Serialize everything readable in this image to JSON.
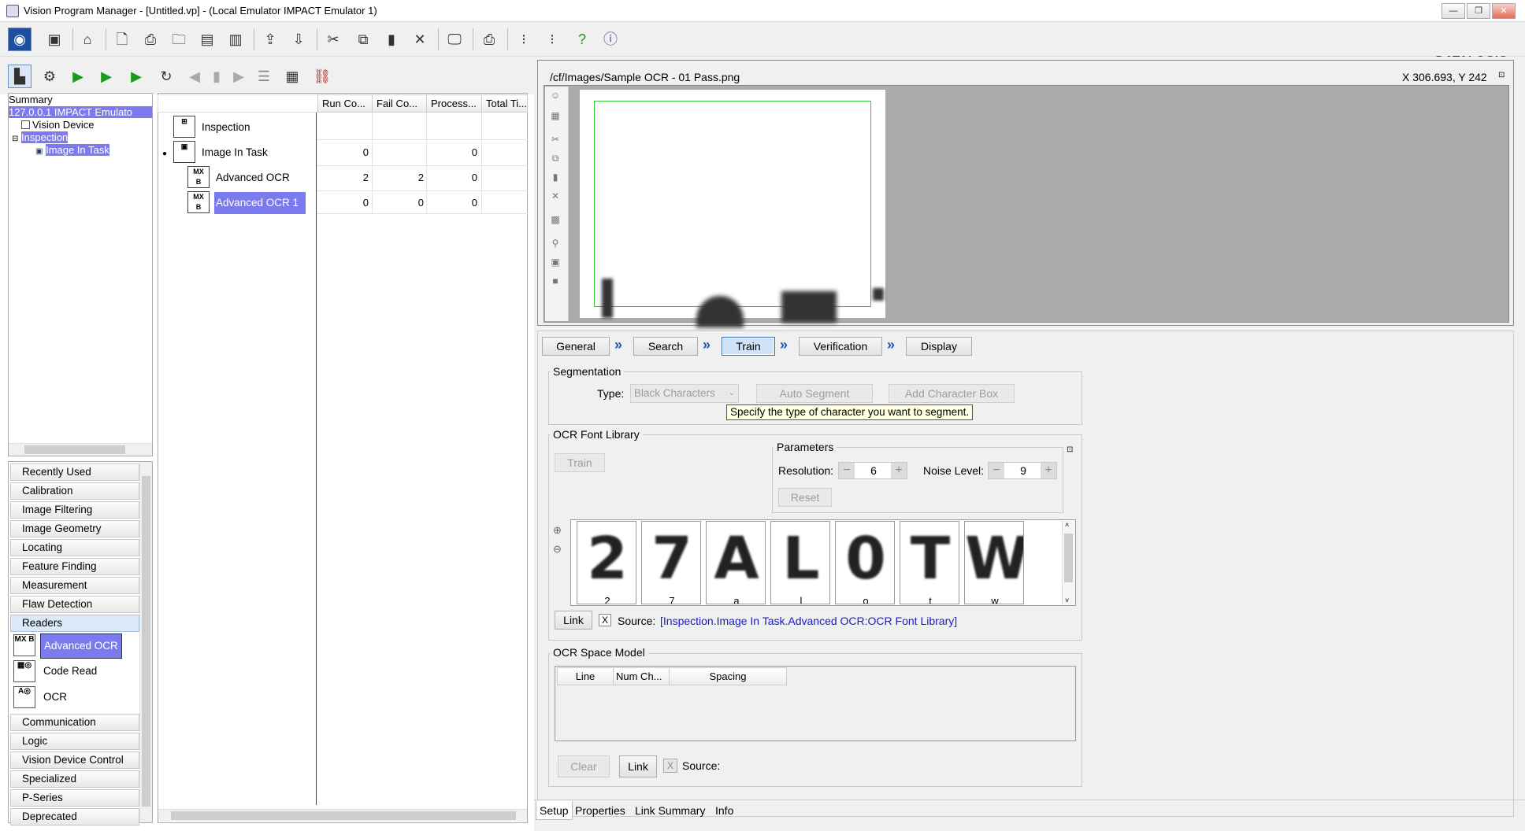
{
  "window": {
    "title": "Vision Program Manager - [Untitled.vp] - (Local Emulator IMPACT Emulator 1)",
    "minimize": "—",
    "restore": "❐",
    "close": "✕"
  },
  "brand": {
    "logo": "DATALOGIC"
  },
  "tree": {
    "items": [
      "Summary",
      "127.0.0.1 IMPACT Emulato",
      "Vision Device",
      "Inspection",
      "Image In Task"
    ]
  },
  "categories": {
    "items": [
      "Recently Used",
      "Calibration",
      "Image Filtering",
      "Image Geometry",
      "Locating",
      "Feature Finding",
      "Measurement",
      "Flaw Detection",
      "Readers"
    ],
    "tools": [
      "Advanced OCR",
      "Code Read",
      "OCR"
    ],
    "after": [
      "Communication",
      "Logic",
      "Vision Device Control",
      "Specialized",
      "P-Series",
      "Deprecated"
    ]
  },
  "grid": {
    "headers": [
      "Run Co...",
      "Fail Co...",
      "Process...",
      "Total Ti..."
    ],
    "rows": [
      {
        "name": "Inspection",
        "run": "",
        "fail": "",
        "proc": ""
      },
      {
        "name": "Image In Task",
        "run": "0",
        "fail": "",
        "proc": "0"
      },
      {
        "name": "Advanced OCR",
        "run": "2",
        "fail": "2",
        "proc": "0"
      },
      {
        "name": "Advanced OCR 1",
        "run": "0",
        "fail": "0",
        "proc": "0"
      }
    ]
  },
  "image": {
    "path": "/cf/Images/Sample OCR - 01 Pass.png",
    "coords": "X 306.693,  Y 242"
  },
  "tabs": [
    "General",
    "Search",
    "Train",
    "Verification",
    "Display"
  ],
  "segmentation": {
    "title": "Segmentation",
    "type_label": "Type:",
    "type_value": "Black Characters",
    "auto_segment": "Auto Segment",
    "add_box": "Add Character Box",
    "tooltip": "Specify the type of character you want to segment."
  },
  "font_library": {
    "title": "OCR Font Library",
    "train": "Train",
    "params_title": "Parameters",
    "resolution_label": "Resolution:",
    "resolution": "6",
    "noise_label": "Noise Level:",
    "noise": "9",
    "reset": "Reset",
    "glyphs": [
      {
        "char": "2",
        "label": "2"
      },
      {
        "char": "7",
        "label": "7"
      },
      {
        "char": "A",
        "label": "a"
      },
      {
        "char": "L",
        "label": "l"
      },
      {
        "char": "0",
        "label": "o"
      },
      {
        "char": "T",
        "label": "t"
      },
      {
        "char": "W",
        "label": "w"
      }
    ],
    "link": "Link",
    "check": "X",
    "source_label": "Source:",
    "source_value": "[Inspection.Image In Task.Advanced OCR:OCR Font Library]"
  },
  "space_model": {
    "title": "OCR Space Model",
    "headers": [
      "Line",
      "Num Ch...",
      "Spacing"
    ],
    "clear": "Clear",
    "link": "Link",
    "check": "X",
    "source_label": "Source:"
  },
  "bottom_tabs": [
    "Setup",
    "Properties",
    "Link Summary",
    "Info"
  ],
  "colors": {
    "highlight": "#7b7bef",
    "roi": "#33cc33",
    "accent": "#1f57b8"
  }
}
